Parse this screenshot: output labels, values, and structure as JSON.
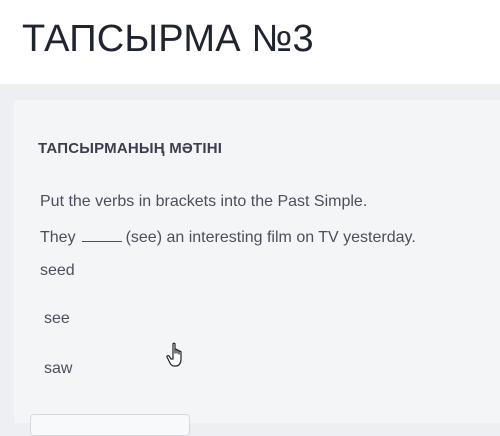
{
  "header": {
    "title": "ТАПСЫРМА №3"
  },
  "task": {
    "heading": "ТАПСЫРМАНЫҢ МӘТІНІ",
    "instruction": "Put the verbs in brackets into the Past Simple.",
    "sentence_start": "They",
    "sentence_end": "(see) an interesting film on TV yesterday."
  },
  "options": [
    "seed",
    "see",
    "saw"
  ],
  "icons": {
    "cursor": "hand-pointer-icon"
  }
}
